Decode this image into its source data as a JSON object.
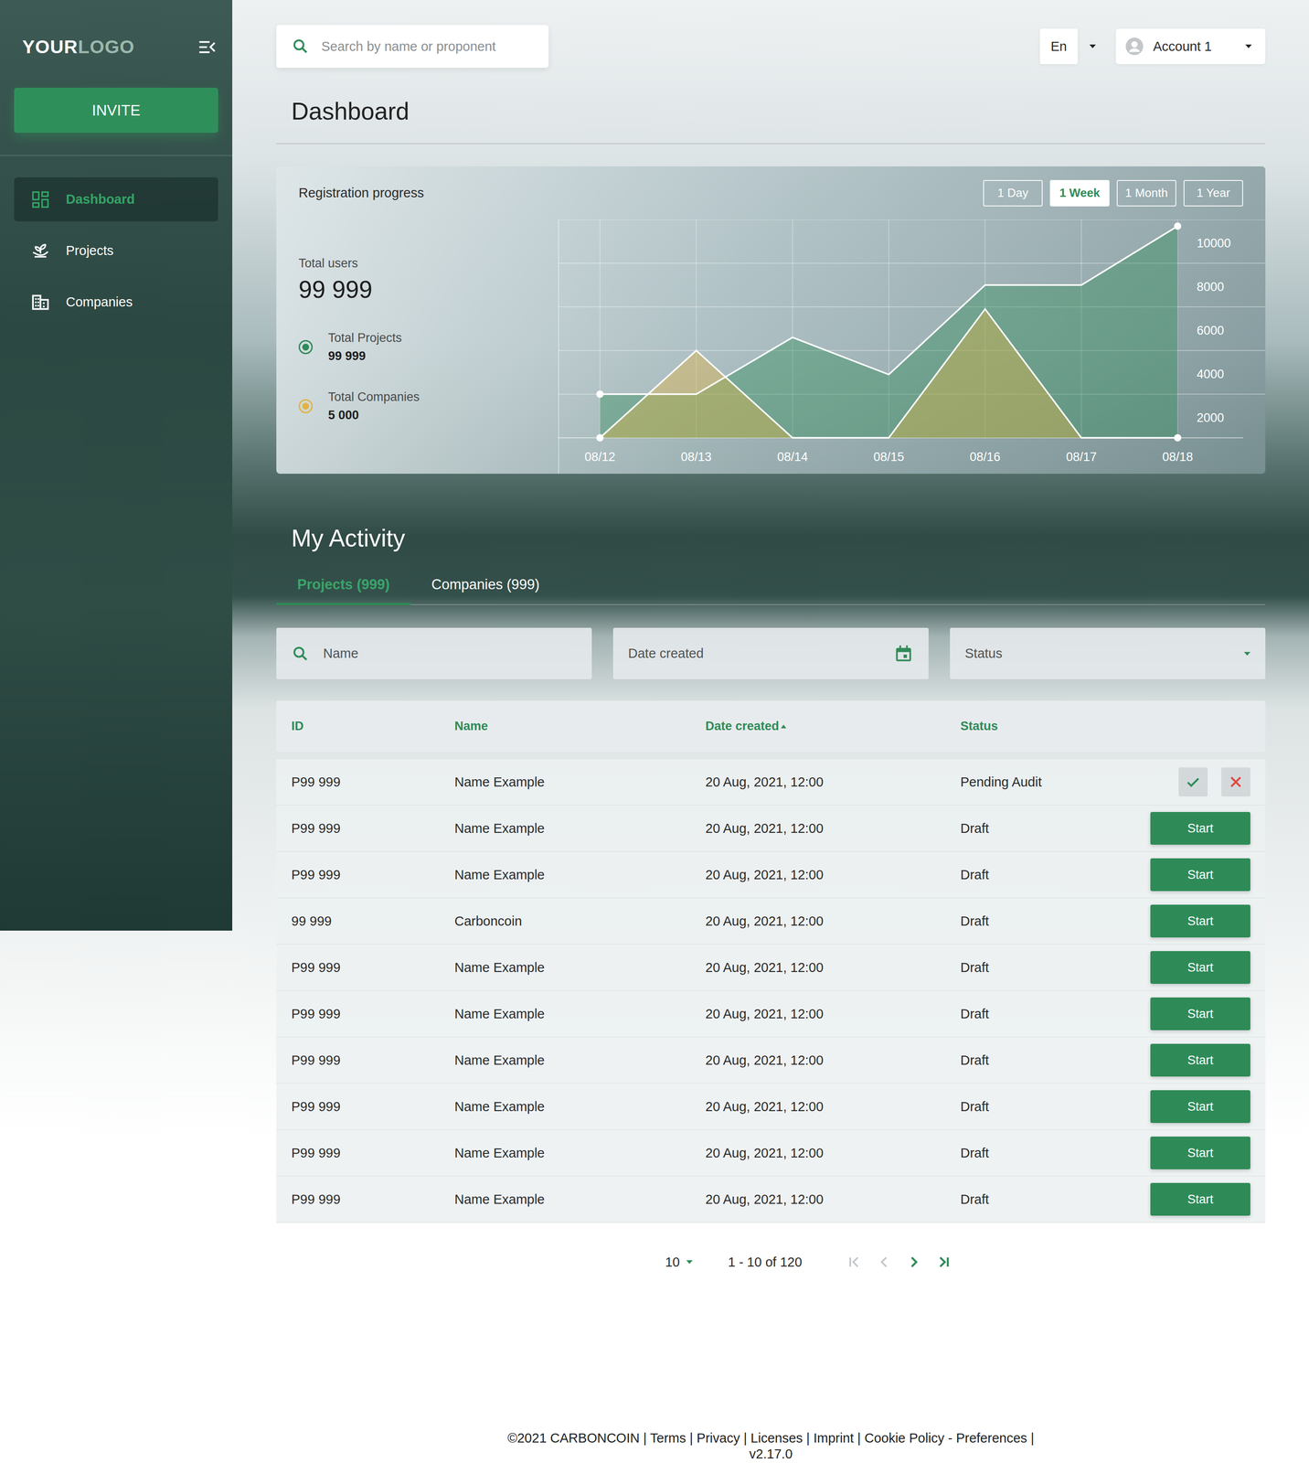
{
  "logo": {
    "part1": "YOUR",
    "part2": "LOGO"
  },
  "sidebar": {
    "invite": "INVITE",
    "items": [
      {
        "label": "Dashboard",
        "selected": true,
        "kind": "dashboard"
      },
      {
        "label": "Projects",
        "selected": false,
        "kind": "projects"
      },
      {
        "label": "Companies",
        "selected": false,
        "kind": "companies"
      }
    ]
  },
  "search": {
    "placeholder": "Search by name or proponent"
  },
  "language": {
    "value": "En"
  },
  "account": {
    "name": "Account 1"
  },
  "page_title": "Dashboard",
  "chart": {
    "title": "Registration progress",
    "ranges": [
      {
        "label": "1 Day",
        "selected": false
      },
      {
        "label": "1 Week",
        "selected": true
      },
      {
        "label": "1 Month",
        "selected": false
      },
      {
        "label": "1 Year",
        "selected": false
      }
    ],
    "total_users_label": "Total users",
    "total_users": "99 999",
    "series": [
      {
        "name": "Total Projects",
        "total": "99 999",
        "color": "#2e8b57",
        "values": [
          2000,
          2000,
          4600,
          2900,
          7000,
          7000,
          9700
        ]
      },
      {
        "name": "Total Companies",
        "total": "5 000",
        "color": "#e3b341",
        "values": [
          0,
          4000,
          0,
          0,
          5900,
          0,
          0
        ]
      }
    ],
    "x_labels": [
      "08/12",
      "08/13",
      "08/14",
      "08/15",
      "08/16",
      "08/17",
      "08/18"
    ],
    "y_ticks": [
      "10000",
      "8000",
      "6000",
      "4000",
      "2000"
    ]
  },
  "activity": {
    "title": "My Activity",
    "tabs": [
      {
        "label": "Projects (999)",
        "selected": true
      },
      {
        "label": "Companies (999)",
        "selected": false
      }
    ],
    "filters": {
      "name": "Name",
      "date": "Date created",
      "status": "Status"
    },
    "columns": [
      {
        "label": "ID",
        "sorted": false
      },
      {
        "label": "Name",
        "sorted": false
      },
      {
        "label": "Date created",
        "sorted": true
      },
      {
        "label": "Status",
        "sorted": false
      }
    ],
    "rows": [
      {
        "id": "P99 999",
        "name": "Name Example",
        "date": "20 Aug, 2021, 12:00",
        "status": "Pending Audit",
        "kind": "review"
      },
      {
        "id": "P99 999",
        "name": "Name Example",
        "date": "20 Aug, 2021, 12:00",
        "status": "Draft",
        "kind": "start",
        "action": "Start"
      },
      {
        "id": "P99 999",
        "name": "Name Example",
        "date": "20 Aug, 2021, 12:00",
        "status": "Draft",
        "kind": "start",
        "action": "Start"
      },
      {
        "id": "99 999",
        "name": "Carboncoin",
        "date": "20 Aug, 2021, 12:00",
        "status": "Draft",
        "kind": "start",
        "action": "Start"
      },
      {
        "id": "P99 999",
        "name": "Name Example",
        "date": "20 Aug, 2021, 12:00",
        "status": "Draft",
        "kind": "start",
        "action": "Start"
      },
      {
        "id": "P99 999",
        "name": "Name Example",
        "date": "20 Aug, 2021, 12:00",
        "status": "Draft",
        "kind": "start",
        "action": "Start"
      },
      {
        "id": "P99 999",
        "name": "Name Example",
        "date": "20 Aug, 2021, 12:00",
        "status": "Draft",
        "kind": "start",
        "action": "Start"
      },
      {
        "id": "P99 999",
        "name": "Name Example",
        "date": "20 Aug, 2021, 12:00",
        "status": "Draft",
        "kind": "start",
        "action": "Start"
      },
      {
        "id": "P99 999",
        "name": "Name Example",
        "date": "20 Aug, 2021, 12:00",
        "status": "Draft",
        "kind": "start",
        "action": "Start"
      },
      {
        "id": "P99 999",
        "name": "Name Example",
        "date": "20 Aug, 2021, 12:00",
        "status": "Draft",
        "kind": "start",
        "action": "Start"
      }
    ]
  },
  "pagination": {
    "page_size": "10",
    "range": "1 - 10 of 120",
    "buttons": [
      {
        "kind": "first",
        "disabled": true
      },
      {
        "kind": "prev",
        "disabled": true
      },
      {
        "kind": "next",
        "disabled": false
      },
      {
        "kind": "last",
        "disabled": false
      }
    ]
  },
  "footer": {
    "line": "©2021 CARBONCOIN | Terms | Privacy | Licenses | Imprint | Cookie Policy - Preferences |",
    "version": "v2.17.0"
  }
}
